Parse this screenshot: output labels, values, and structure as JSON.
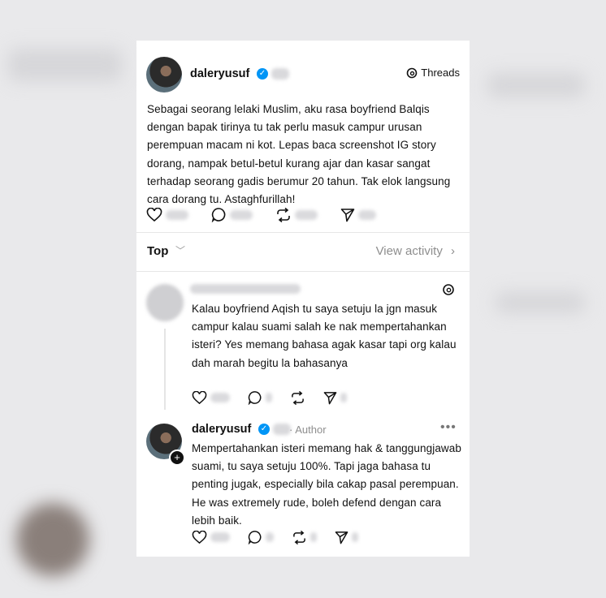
{
  "post": {
    "username": "daleryusuf",
    "brand": "Threads",
    "text": "Sebagai seorang lelaki Muslim, aku rasa boyfriend Balqis dengan bapak tirinya tu tak perlu masuk campur urusan perempuan macam ni kot. Lepas baca screenshot IG story dorang, nampak betul-betul kurang ajar dan kasar sangat terhadap seorang gadis berumur 20 tahun. Tak elok langsung cara dorang tu. Astaghfurillah!"
  },
  "sort": {
    "label": "Top",
    "view_activity": "View activity"
  },
  "replies": [
    {
      "text": "Kalau boyfriend Aqish tu saya setuju la jgn masuk campur kalau suami salah ke nak mempertahankan isteri? Yes memang bahasa agak kasar tapi org kalau dah marah begitu la bahasanya"
    },
    {
      "username": "daleryusuf",
      "badge": "Author",
      "text": "Mempertahankan isteri memang hak & tanggungjawab suami, tu saya setuju 100%. Tapi jaga bahasa tu penting jugak, especially bila cakap pasal perempuan. He was extremely rude, boleh defend dengan cara lebih baik."
    }
  ],
  "icons": [
    "heart-icon",
    "comment-icon",
    "repost-icon",
    "share-icon",
    "threads-logo-icon",
    "more-icon",
    "verified-icon",
    "chevron-down-icon",
    "chevron-right-icon",
    "plus-icon"
  ],
  "colors": {
    "verified": "#0095f6",
    "muted": "#8e8e8e"
  }
}
